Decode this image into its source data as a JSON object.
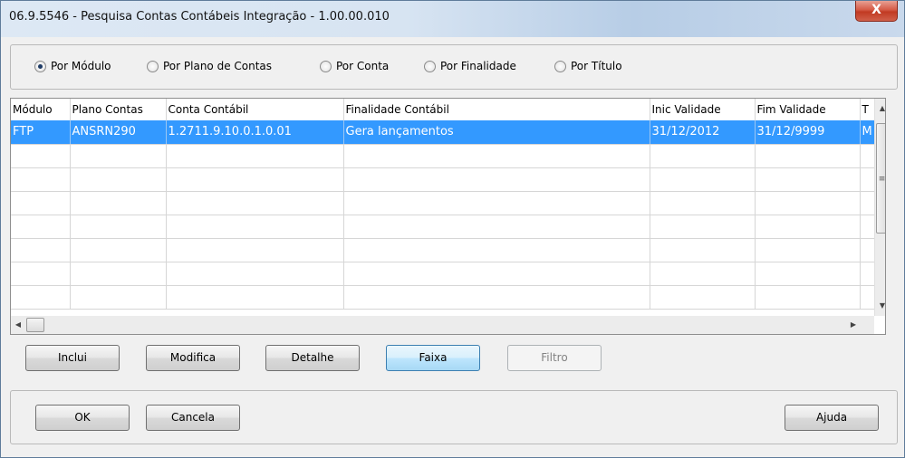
{
  "window": {
    "title": "06.9.5546 - Pesquisa Contas Contábeis Integração - 1.00.00.010",
    "close_label": "X"
  },
  "search_options": [
    {
      "label": "Por Módulo",
      "checked": true
    },
    {
      "label": "Por Plano de Contas",
      "checked": false
    },
    {
      "label": "Por Conta",
      "checked": false
    },
    {
      "label": "Por Finalidade",
      "checked": false
    },
    {
      "label": "Por Título",
      "checked": false
    }
  ],
  "grid": {
    "columns": [
      "Módulo",
      "Plano Contas",
      "Conta Contábil",
      "Finalidade Contábil",
      "Inic Validade",
      "Fim Validade",
      "T"
    ],
    "rows": [
      [
        "FTP",
        "ANSRN290",
        "1.2711.9.10.0.1.0.01",
        "Gera lançamentos",
        "31/12/2012",
        "31/12/9999",
        "M"
      ]
    ],
    "selected_row": 0
  },
  "actions": {
    "inclui": "Inclui",
    "modifica": "Modifica",
    "detalhe": "Detalhe",
    "faixa": "Faixa",
    "filtro": "Filtro"
  },
  "footer": {
    "ok": "OK",
    "cancela": "Cancela",
    "ajuda": "Ajuda"
  },
  "colors": {
    "selection": "#3399ff",
    "close_button": "#c13a22"
  }
}
